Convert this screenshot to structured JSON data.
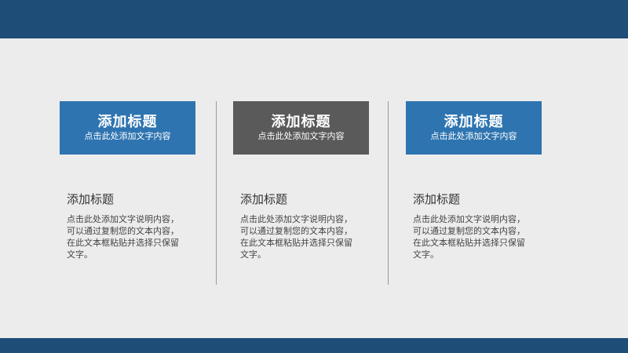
{
  "colors": {
    "bar": "#1e4d78",
    "background": "#ececec",
    "box_blue": "#2e74b0",
    "box_gray": "#5a5a5a"
  },
  "columns": [
    {
      "header_title": "添加标题",
      "header_subtitle": "点击此处添加文字内容",
      "subtitle": "添加标题",
      "body": "点击此处添加文字说明内容，可以通过复制您的文本内容，在此文本框粘贴并选择只保留文字。"
    },
    {
      "header_title": "添加标题",
      "header_subtitle": "点击此处添加文字内容",
      "subtitle": "添加标题",
      "body": "点击此处添加文字说明内容，可以通过复制您的文本内容，在此文本框粘贴并选择只保留文字。"
    },
    {
      "header_title": "添加标题",
      "header_subtitle": "点击此处添加文字内容",
      "subtitle": "添加标题",
      "body": "点击此处添加文字说明内容，可以通过复制您的文本内容，在此文本框粘贴并选择只保留文字。"
    }
  ]
}
